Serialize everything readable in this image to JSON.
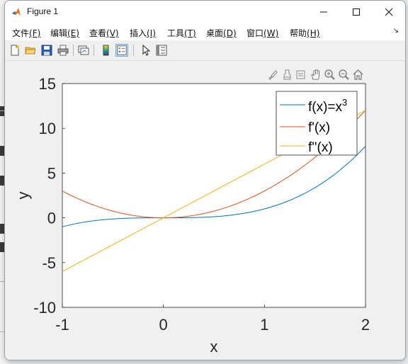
{
  "window": {
    "title": "Figure 1"
  },
  "menu": {
    "items": [
      {
        "label": "文件",
        "mnemonic": "(F)"
      },
      {
        "label": "编辑",
        "mnemonic": "(E)"
      },
      {
        "label": "查看",
        "mnemonic": "(V)"
      },
      {
        "label": "插入",
        "mnemonic": "(I)"
      },
      {
        "label": "工具",
        "mnemonic": "(T)"
      },
      {
        "label": "桌面",
        "mnemonic": "(D)"
      },
      {
        "label": "窗口",
        "mnemonic": "(W)"
      },
      {
        "label": "帮助",
        "mnemonic": "(H)"
      }
    ],
    "overflow_icon": "menu-overflow-arrow"
  },
  "toolbar": {
    "buttons": [
      "new-figure-icon",
      "open-file-icon",
      "save-icon",
      "print-icon",
      "link-plot-icon",
      "colorbar-icon",
      "legend-icon",
      "edit-plot-icon",
      "property-inspector-icon"
    ],
    "pressed": "legend-icon"
  },
  "axes_toolbar": {
    "buttons": [
      "brush-icon",
      "data-tips-icon",
      "export-icon",
      "pan-icon",
      "zoom-in-icon",
      "zoom-out-icon",
      "home-icon"
    ]
  },
  "colors": {
    "f": "#0072BD",
    "f1": "#D95319",
    "f2": "#EDB120",
    "axis_bg": "#ffffff",
    "figure_bg": "#f0f0f0"
  },
  "chart_data": {
    "type": "line",
    "title": "",
    "xlabel": "x",
    "ylabel": "y",
    "xlim": [
      -1,
      2
    ],
    "ylim": [
      -10,
      15
    ],
    "xticks": [
      "-1",
      "0",
      "1",
      "2"
    ],
    "yticks": [
      "15",
      "10",
      "5",
      "0",
      "-5",
      "-10"
    ],
    "xtick_values": [
      -1,
      0,
      1,
      2
    ],
    "ytick_values": [
      15,
      10,
      5,
      0,
      -5,
      -10
    ],
    "grid": false,
    "legend_position": "top-right",
    "series": [
      {
        "name": "f(x)=x",
        "name_sup": "3",
        "expr": "x^3",
        "x": [
          -1,
          -0.5,
          0,
          0.5,
          1,
          1.5,
          2
        ],
        "y": [
          -1,
          -0.125,
          0,
          0.125,
          1,
          3.375,
          8
        ],
        "color": "#0072BD"
      },
      {
        "name": "f'(x)",
        "expr": "3x^2",
        "x": [
          -1,
          -0.5,
          0,
          0.5,
          1,
          1.5,
          2
        ],
        "y": [
          3,
          0.75,
          0,
          0.75,
          3,
          6.75,
          12
        ],
        "color": "#D95319"
      },
      {
        "name": "f''(x)",
        "expr": "6x",
        "x": [
          -1,
          -0.5,
          0,
          0.5,
          1,
          1.5,
          2
        ],
        "y": [
          -6,
          -3,
          0,
          3,
          6,
          9,
          12
        ],
        "color": "#EDB120"
      }
    ]
  }
}
